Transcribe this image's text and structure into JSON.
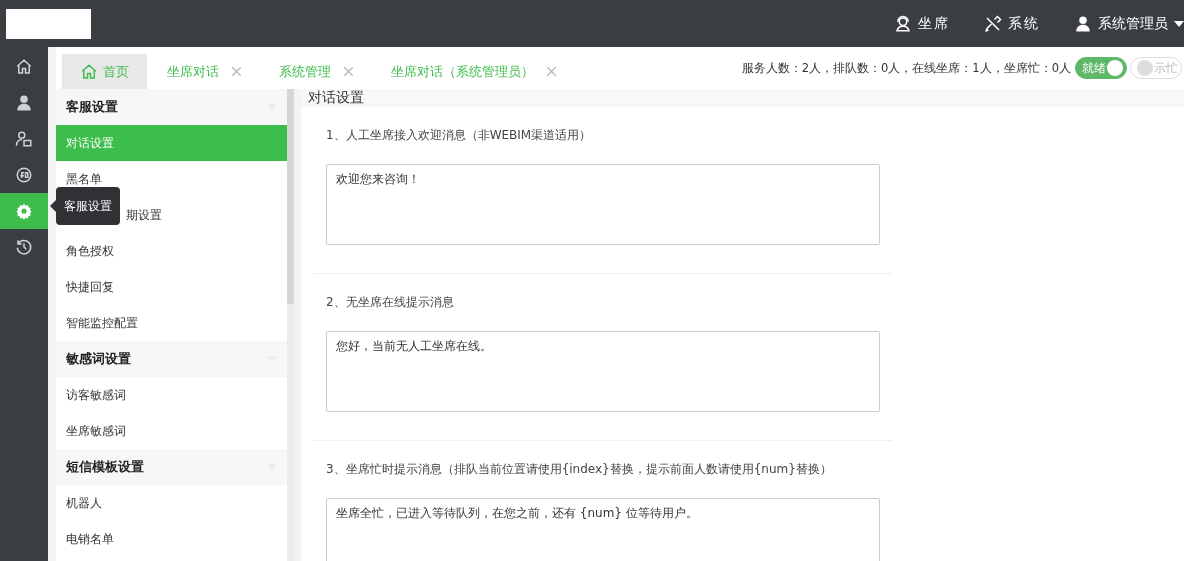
{
  "topbar": {
    "nav": [
      {
        "label": "坐席"
      },
      {
        "label": "系统"
      }
    ],
    "user": {
      "label": "系统管理员"
    }
  },
  "rail": [
    {
      "selected": false
    },
    {
      "selected": false
    },
    {
      "selected": false
    },
    {
      "selected": false
    },
    {
      "selected": true
    },
    {
      "selected": false
    }
  ],
  "tooltip": "客服设置",
  "tabs": [
    {
      "label": "首页",
      "kind": "home",
      "selected": true
    },
    {
      "label": "坐席对话",
      "kind": "closable",
      "selected": false
    },
    {
      "label": "系统管理",
      "kind": "closable",
      "selected": false
    },
    {
      "label": "坐席对话（系统管理员）",
      "kind": "closable",
      "selected": false
    }
  ],
  "status_text": "服务人数：2人，排队数：0人，在线坐席：1人，坐席忙：0人",
  "toggles": [
    {
      "label": "就绪",
      "on": true
    },
    {
      "label": "示忙",
      "on": false
    }
  ],
  "menu": [
    {
      "title": "客服设置",
      "items": [
        {
          "label": "对话设置",
          "selected": true,
          "covered": false
        },
        {
          "label": "黑名单",
          "selected": false,
          "covered": false
        },
        {
          "label": "期设置",
          "selected": false,
          "covered": true
        },
        {
          "label": "角色授权",
          "selected": false,
          "covered": false
        },
        {
          "label": "快捷回复",
          "selected": false,
          "covered": false
        },
        {
          "label": "智能监控配置",
          "selected": false,
          "covered": false
        }
      ]
    },
    {
      "title": "敏感词设置",
      "items": [
        {
          "label": "访客敏感词",
          "selected": false,
          "covered": false
        },
        {
          "label": "坐席敏感词",
          "selected": false,
          "covered": false
        }
      ]
    },
    {
      "title": "短信模板设置",
      "items": [
        {
          "label": "机器人",
          "selected": false,
          "covered": false
        },
        {
          "label": "电销名单",
          "selected": false,
          "covered": false
        }
      ]
    }
  ],
  "panel": {
    "title": "对话设置",
    "sections": [
      {
        "label": "1、人工坐席接入欢迎消息（非WEBIM渠道适用）",
        "value": "欢迎您来咨询！"
      },
      {
        "label": "2、无坐席在线提示消息",
        "value": "您好，当前无人工坐席在线。"
      },
      {
        "label": "3、坐席忙时提示消息（排队当前位置请使用{index}替换，提示前面人数请使用{num}替换）",
        "value": "坐席全忙，已进入等待队列，在您之前，还有 {num} 位等待用户。"
      }
    ]
  }
}
